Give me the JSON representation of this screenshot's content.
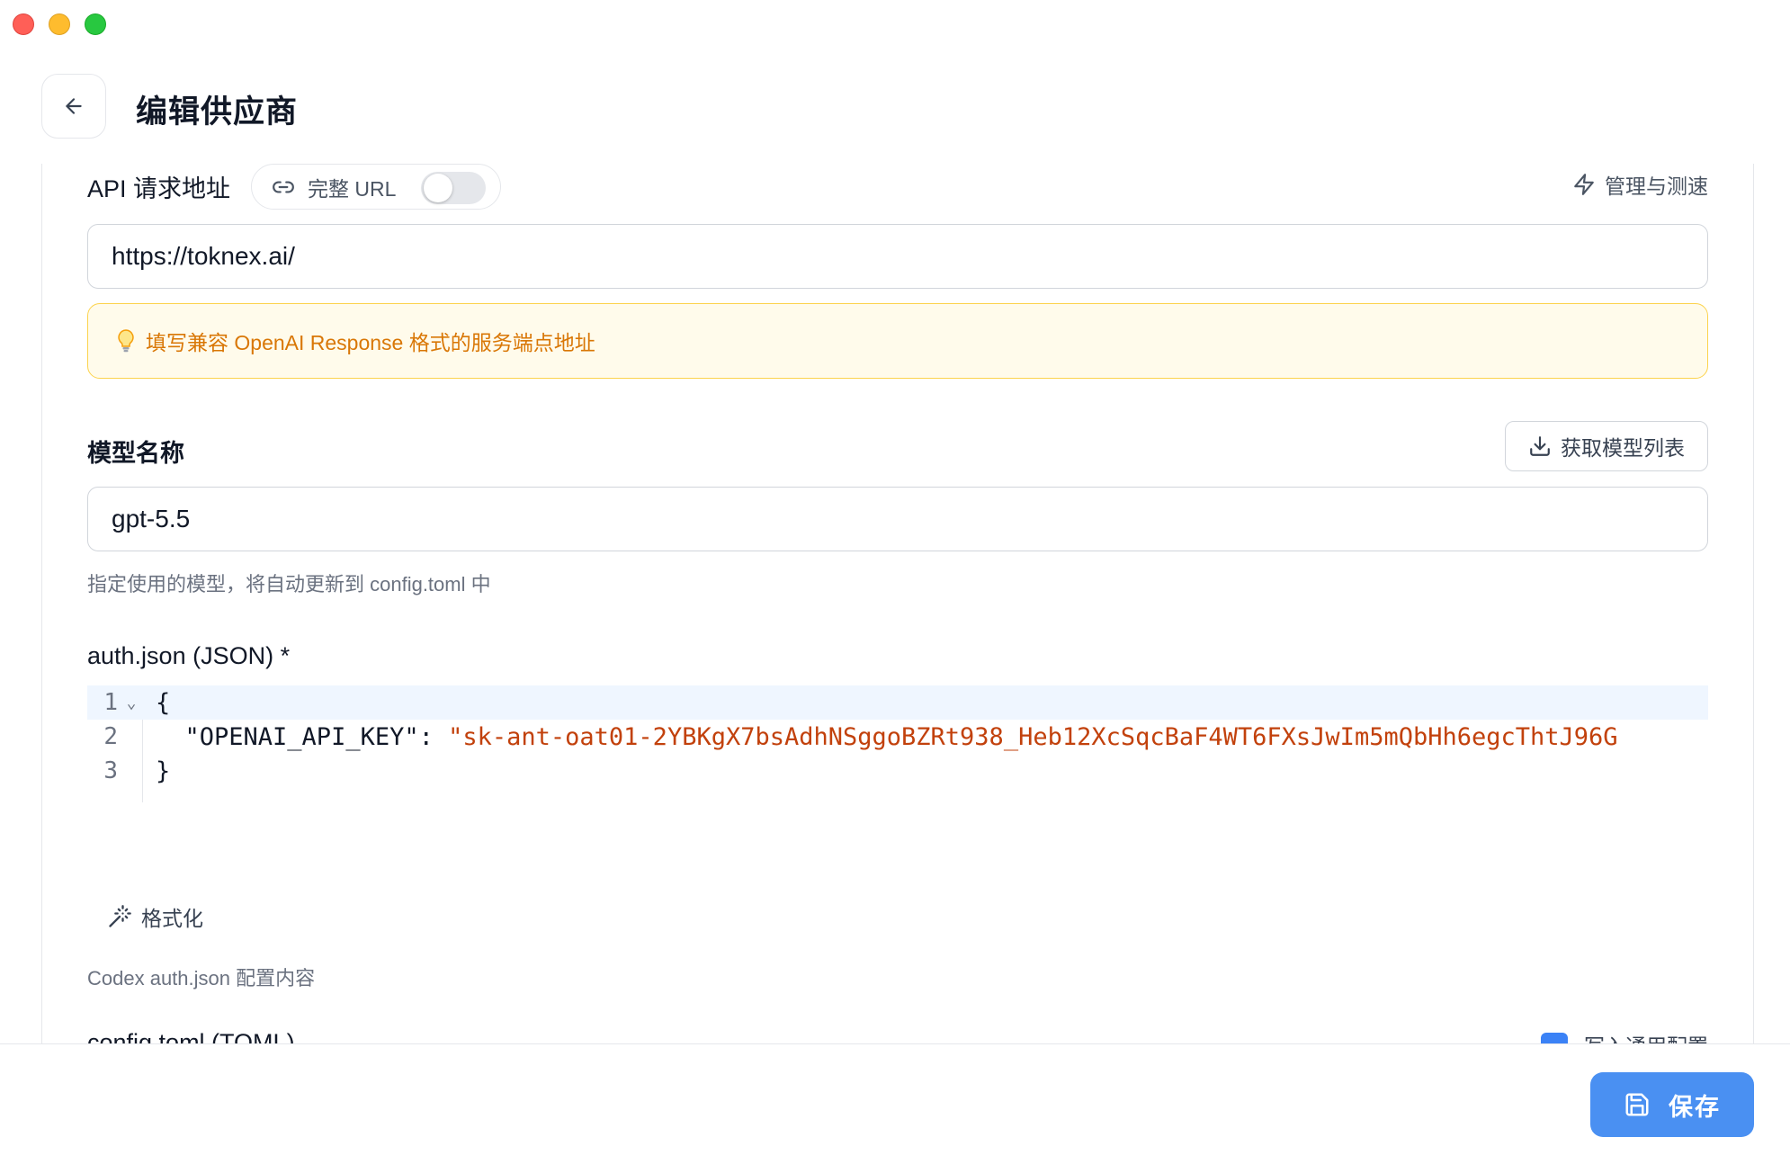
{
  "window": {
    "controls": [
      "close",
      "minimize",
      "zoom"
    ]
  },
  "header": {
    "title": "编辑供应商",
    "back_icon": "arrow-left-icon"
  },
  "api_url": {
    "label": "API 请求地址",
    "full_url_toggle_label": "完整 URL",
    "full_url_enabled": false,
    "manage_label": "管理与测速",
    "value": "https://toknex.ai/",
    "hint": "填写兼容 OpenAI Response 格式的服务端点地址"
  },
  "model": {
    "label": "模型名称",
    "fetch_button_label": "获取模型列表",
    "value": "gpt-5.5",
    "help": "指定使用的模型，将自动更新到 config.toml 中"
  },
  "auth_json": {
    "label": "auth.json (JSON) *",
    "lines": [
      {
        "number": "1",
        "text": "{"
      },
      {
        "number": "2",
        "key": "  \"OPENAI_API_KEY\": ",
        "value": "\"sk-ant-oat01-2YBKgX7bsAdhNSggoBZRt938_Heb12XcSqcBaF4WT6FXsJwIm5mQbHh6egcThtJ96G"
      },
      {
        "number": "3",
        "text": "}"
      }
    ],
    "format_button_label": "格式化",
    "help": "Codex auth.json 配置内容"
  },
  "next_section": {
    "label": "config.toml (TOML)",
    "checkbox_checked": true,
    "right_label": "写入通用配置"
  },
  "footer": {
    "save_label": "保存"
  }
}
